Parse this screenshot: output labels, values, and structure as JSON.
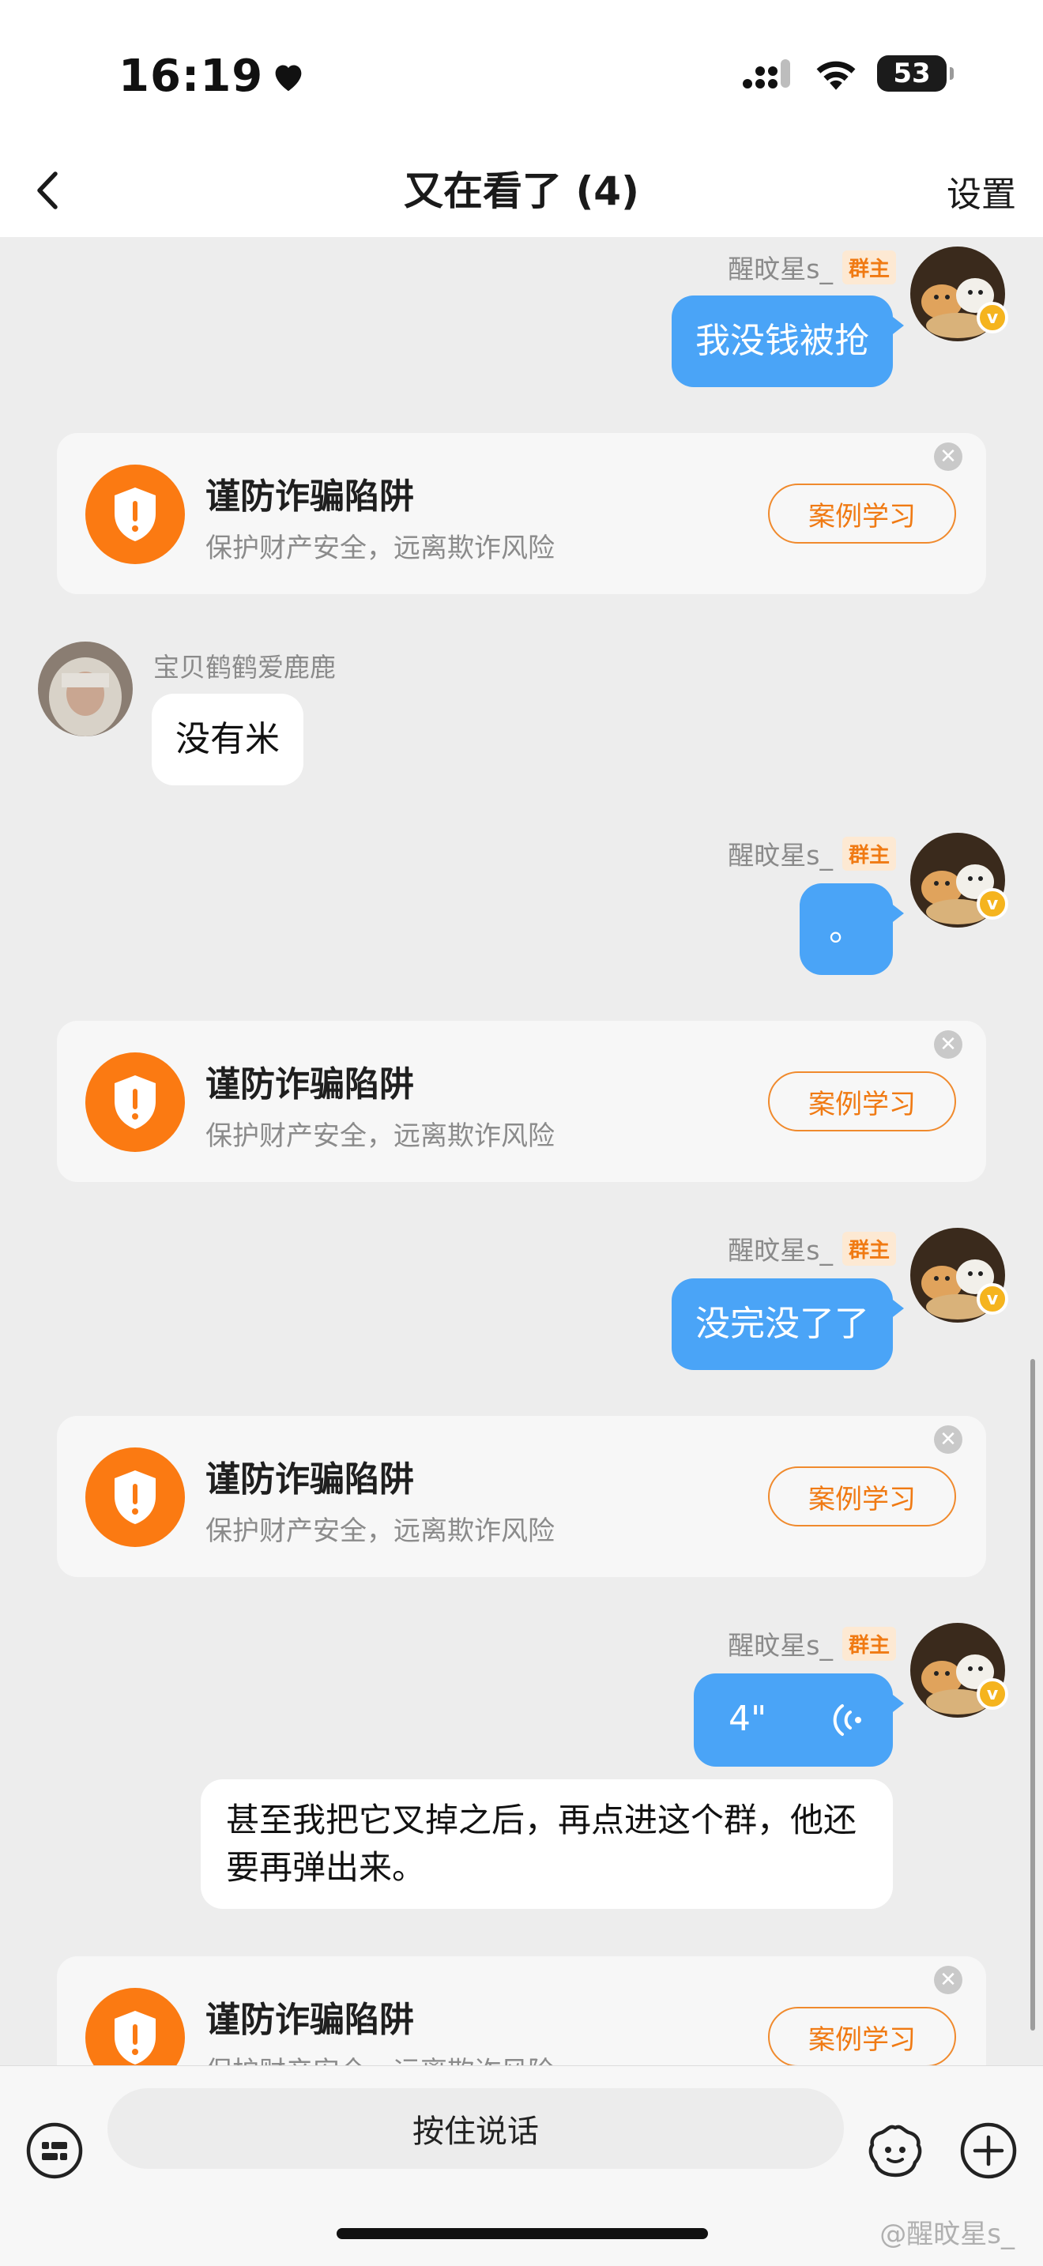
{
  "status": {
    "time": "16:19",
    "battery": "53"
  },
  "nav": {
    "title": "又在看了 (4)",
    "settings": "设置"
  },
  "owner_tag": "群主",
  "me_name": "醒旼星s_",
  "other_name": "宝贝鹤鹤爱鹿鹿",
  "messages": {
    "m1": "我没钱被抢",
    "m2": "没有米",
    "m3": "。",
    "m4": "没完没了了",
    "m5_voice": "4\"",
    "m5_transcript": "甚至我把它叉掉之后，再点进这个群，他还要再弹出来。"
  },
  "fraud_card": {
    "title": "谨防诈骗陷阱",
    "subtitle": "保护财产安全，远离欺诈风险",
    "button": "案例学习"
  },
  "input": {
    "voice_label": "按住说话"
  },
  "watermark": "@醒旼星s_",
  "colors": {
    "accent_blue": "#4aa4f7",
    "orange": "#fb7a12",
    "owner_tag": "#f07a13"
  },
  "icons": [
    "back-icon",
    "heart-icon",
    "signal-icon",
    "wifi-icon",
    "battery-icon",
    "shield-alert-icon",
    "close-icon",
    "voice-wave-icon",
    "keyboard-voice-icon",
    "emoji-icon",
    "plus-icon"
  ]
}
